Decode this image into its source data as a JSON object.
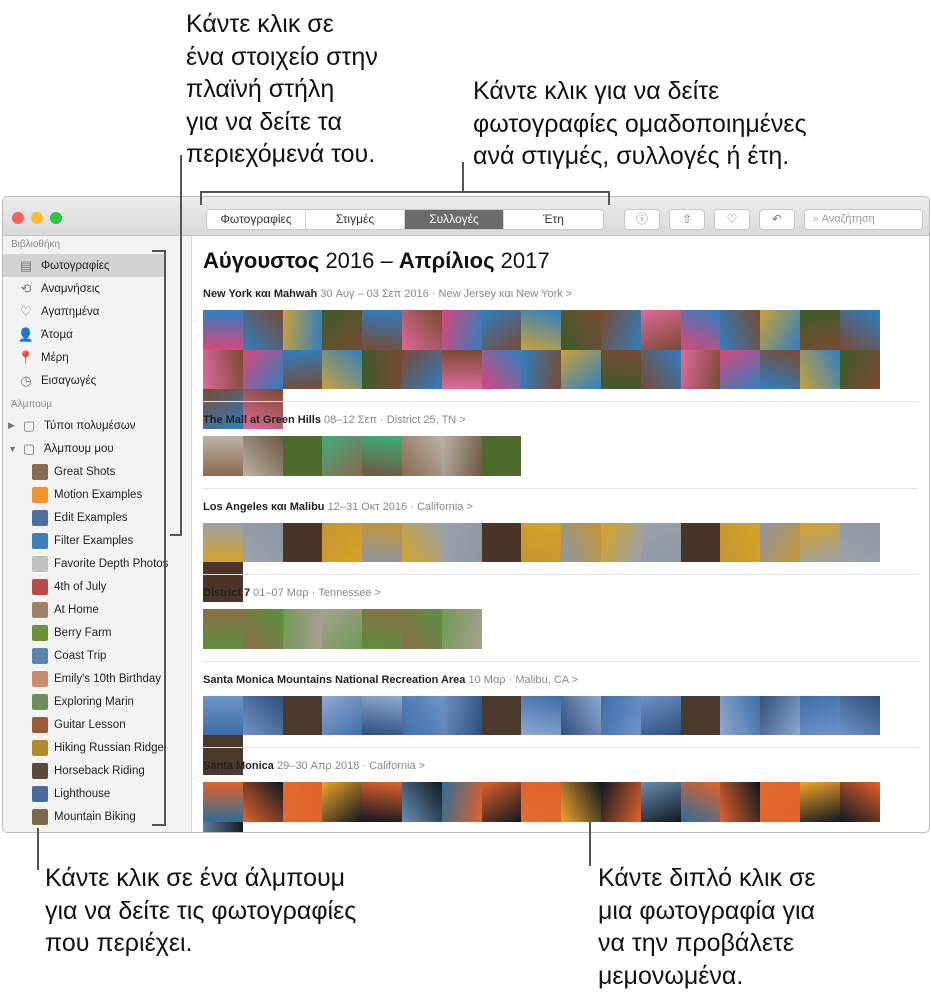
{
  "callouts": {
    "sidebar": "Κάντε κλικ σε\nένα στοιχείο στην\nπλαϊνή στήλη\nγια να δείτε τα\nπεριεχόμενά του.",
    "toolbar": "Κάντε κλικ για να δείτε\nφωτογραφίες ομαδοποιημένες\nανά στιγμές, συλλογές ή έτη.",
    "album": "Κάντε κλικ σε ένα άλμπουμ\nγια να δείτε τις φωτογραφίες\nπου περιέχει.",
    "photo": "Κάντε διπλό κλικ σε\nμια φωτογραφία για\nνα την προβάλετε\nμεμονωμένα."
  },
  "toolbar": {
    "tabs": [
      "Φωτογραφίες",
      "Στιγμές",
      "Συλλογές",
      "Έτη"
    ],
    "selected": "Συλλογές",
    "search_placeholder": "Αναζήτηση",
    "buttons": [
      "info-icon",
      "share-icon",
      "heart-icon",
      "rotate-icon"
    ]
  },
  "sidebar": {
    "library_header": "Βιβλιοθήκη",
    "library": [
      {
        "label": "Φωτογραφίες",
        "icon": "▤"
      },
      {
        "label": "Αναμνήσεις",
        "icon": "⟲"
      },
      {
        "label": "Αγαπημένα",
        "icon": "♡"
      },
      {
        "label": "Άτομα",
        "icon": "👤"
      },
      {
        "label": "Μέρη",
        "icon": "📍"
      },
      {
        "label": "Εισαγωγές",
        "icon": "◷"
      }
    ],
    "albums_header": "Άλμπουμ",
    "folders": [
      {
        "label": "Τύποι πολυμέσων",
        "disclosure": "▶"
      },
      {
        "label": "Άλμπουμ μου",
        "disclosure": "▼"
      }
    ],
    "albums": [
      "Great Shots",
      "Motion Examples",
      "Edit Examples",
      "Filter Examples",
      "Favorite Depth Photos",
      "4th of July",
      "At Home",
      "Berry Farm",
      "Coast Trip",
      "Emily's 10th Birthday",
      "Exploring Marin",
      "Guitar Lesson",
      "Hiking Russian Ridge",
      "Horseback Riding",
      "Lighthouse",
      "Mountain Biking"
    ]
  },
  "main": {
    "title_month1": "Αύγουστος",
    "title_year1": "2016",
    "title_month2": "Απρίλιος",
    "title_year2": "2017",
    "sections": [
      {
        "title": "New York και Mahwah",
        "meta": "30 Αυγ – 03 Σεπ 2016  ·  New Jersey και New York  >",
        "count": 36,
        "palette": [
          "#d9477a",
          "#2f7fc1",
          "#c8a23a",
          "#3b5d2a",
          "#7a4a33",
          "#e06a9c"
        ]
      },
      {
        "title": "The Mall at Green Hills",
        "meta": "08–12 Σεπ  ·  District 25, TN  >",
        "count": 8,
        "palette": [
          "#8a6a4f",
          "#b9b2a5",
          "#4d6a2f",
          "#3fae7a",
          "#6f5740"
        ]
      },
      {
        "title": "Los Angeles και Malibu",
        "meta": "12–31 Οκτ 2016  ·  California  >",
        "count": 18,
        "palette": [
          "#d6a227",
          "#9aa1a8",
          "#4a3528",
          "#c49430",
          "#8c96a5"
        ]
      },
      {
        "title": "District 7",
        "meta": "01–07 Μαρ  ·  Tennessee  >",
        "count": 7,
        "palette": [
          "#5b8f3c",
          "#8b6e4a",
          "#6f9a55",
          "#a8a090"
        ]
      },
      {
        "title": "Santa Monica Mountains National Recreation Area",
        "meta": "10 Μαρ  ·  Malibu, CA  >",
        "count": 18,
        "palette": [
          "#3f6ea8",
          "#6e93c7",
          "#4a3a2e",
          "#8fa9d0",
          "#2f4f7c"
        ]
      },
      {
        "title": "Santa Monica",
        "meta": "29–30 Απρ 2018  ·  California  >",
        "count": 18,
        "palette": [
          "#2d6e9a",
          "#e2622b",
          "#e36a2e",
          "#f0a42a",
          "#101820",
          "#6a8fb3"
        ]
      }
    ]
  }
}
